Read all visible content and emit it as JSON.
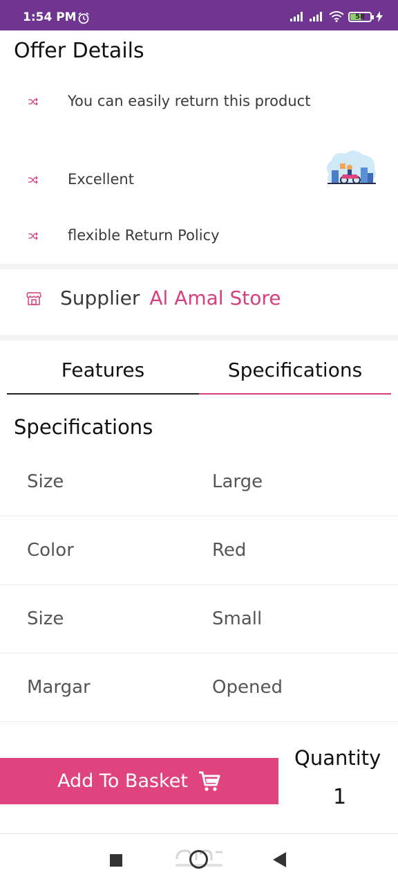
{
  "status_bar": {
    "time": "1:54 PM",
    "battery_level": "58",
    "battery_percent": 58,
    "icons": [
      "alarm-icon",
      "cell-signal-icon",
      "cell-signal-icon",
      "wifi-icon",
      "battery-icon",
      "charging-icon"
    ]
  },
  "offer": {
    "title": "Offer Details",
    "items": [
      {
        "text": "You can easily return this product"
      },
      {
        "text": "Excellent"
      },
      {
        "text": "flexible Return Policy"
      }
    ],
    "bullet_icon": "shuffle-icon"
  },
  "supplier": {
    "label": "Supplier",
    "name": "Al Amal Store",
    "icon": "store-icon"
  },
  "tabs": [
    {
      "label": "Features",
      "active": false
    },
    {
      "label": "Specifications",
      "active": true
    }
  ],
  "specifications": {
    "heading": "Specifications",
    "rows": [
      {
        "key": "Size",
        "value": "Large"
      },
      {
        "key": "Color",
        "value": "Red"
      },
      {
        "key": "Size",
        "value": "Small"
      },
      {
        "key": "Margar",
        "value": "Opened"
      }
    ]
  },
  "cart": {
    "add_label": "Add To Basket",
    "quantity_label": "Quantity",
    "quantity_value": "1"
  },
  "colors": {
    "accent": "#e0447f",
    "status_bar": "#6f3591",
    "supplier_name": "#d63e7d"
  }
}
